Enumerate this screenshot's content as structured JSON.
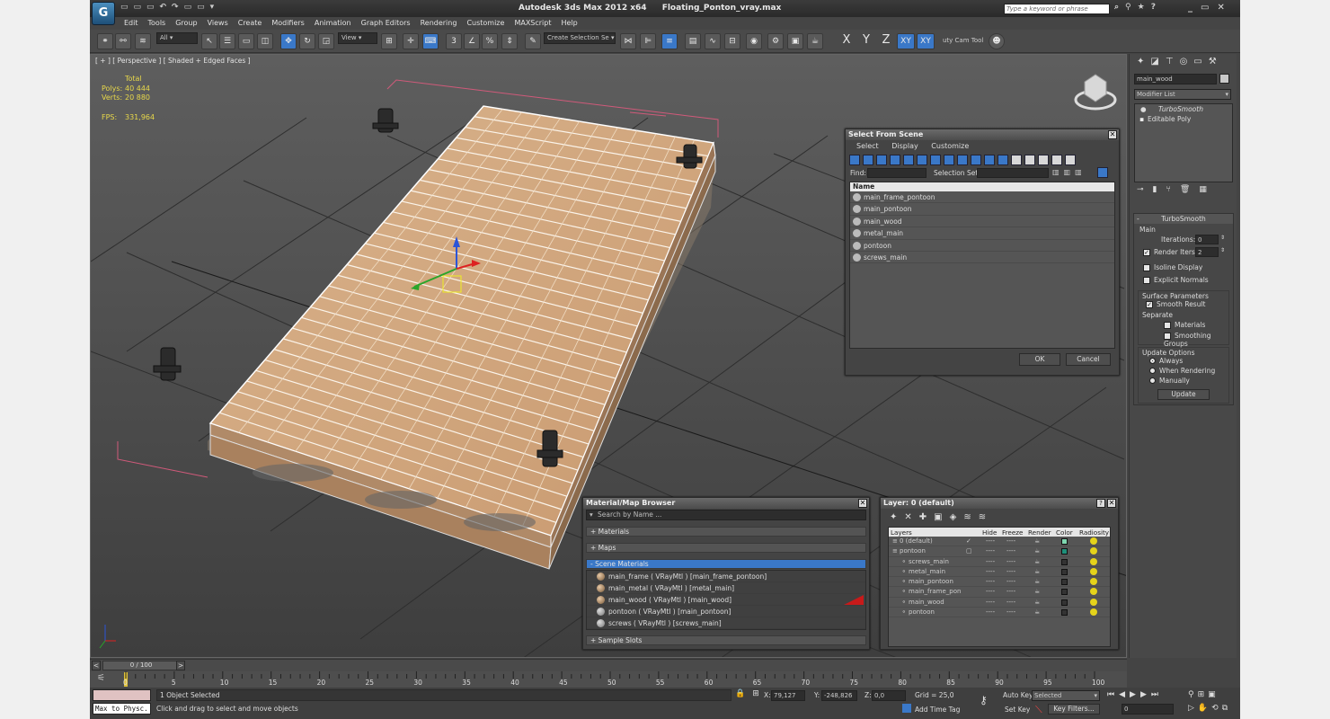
{
  "title": {
    "app": "Autodesk 3ds Max  2012 x64",
    "file": "Floating_Ponton_vray.max",
    "search_placeholder": "Type a keyword or phrase"
  },
  "menu": [
    "Edit",
    "Tools",
    "Group",
    "Views",
    "Create",
    "Modifiers",
    "Animation",
    "Graph Editors",
    "Rendering",
    "Customize",
    "MAXScript",
    "Help"
  ],
  "toolbar": {
    "filter": "All",
    "ref_coord": "View",
    "selection_set": "Create Selection Se",
    "axes": [
      "X",
      "Y",
      "Z",
      "XY",
      "XY"
    ],
    "cam_tool": "uty Cam Tool"
  },
  "viewport": {
    "label": "[ + ] [ Perspective ] [ Shaded + Edged Faces ]",
    "stats_header": "Total",
    "polys_label": "Polys:",
    "polys_value": "40 444",
    "verts_label": "Verts:",
    "verts_value": "20 880",
    "fps_label": "FPS:",
    "fps_value": "331,964"
  },
  "select_scene": {
    "title": "Select From Scene",
    "tabs": [
      "Select",
      "Display",
      "Customize"
    ],
    "find_label": "Find:",
    "selset_label": "Selection Set:",
    "col_name": "Name",
    "items": [
      "main_frame_pontoon",
      "main_pontoon",
      "main_wood",
      "metal_main",
      "pontoon",
      "screws_main"
    ],
    "ok": "OK",
    "cancel": "Cancel"
  },
  "material_browser": {
    "title": "Material/Map Browser",
    "search_placeholder": "Search by Name ...",
    "sections": [
      "+ Materials",
      "+ Maps",
      "- Scene Materials",
      "+ Sample Slots"
    ],
    "materials": [
      "main_frame  ( VRayMtl ) [main_frame_pontoon]",
      "main_metal  ( VRayMtl ) [metal_main]",
      "main_wood  ( VRayMtl ) [main_wood]",
      "pontoon  ( VRayMtl ) [main_pontoon]",
      "screws  ( VRayMtl ) [screws_main]"
    ]
  },
  "layer_manager": {
    "title": "Layer: 0 (default)",
    "help": "?",
    "headers": [
      "Layers",
      "Hide",
      "Freeze",
      "Render",
      "Color",
      "Radiosity"
    ],
    "layers": [
      {
        "name": "0 (default)",
        "color": "#7fd6b0"
      },
      {
        "name": "pontoon",
        "color": "#1e8f7a"
      },
      {
        "name": "screws_main",
        "color": "#333333"
      },
      {
        "name": "metal_main",
        "color": "#333333"
      },
      {
        "name": "main_pontoon",
        "color": "#333333"
      },
      {
        "name": "main_frame_pon",
        "color": "#333333"
      },
      {
        "name": "main_wood",
        "color": "#333333"
      },
      {
        "name": "pontoon",
        "color": "#333333"
      }
    ],
    "dashes": "----"
  },
  "command_panel": {
    "object_name": "main_wood",
    "modifier_list": "Modifier List",
    "stack": [
      "TurboSmooth",
      "Editable Poly"
    ],
    "rollout_title": "TurboSmooth",
    "main_label": "Main",
    "iterations_label": "Iterations:",
    "iterations_value": "0",
    "render_iters_label": "Render Iters:",
    "render_iters_value": "2",
    "isoline": "Isoline Display",
    "explicit": "Explicit Normals",
    "surface_params": "Surface Parameters",
    "smooth_result": "Smooth Result",
    "separate": "Separate",
    "materials": "Materials",
    "smoothing_groups": "Smoothing Groups",
    "update_options": "Update Options",
    "always": "Always",
    "when_rendering": "When Rendering",
    "manually": "Manually",
    "update_btn": "Update"
  },
  "timeline": {
    "slider": "0 / 100",
    "ticks": [
      "0",
      "5",
      "10",
      "15",
      "20",
      "25",
      "30",
      "35",
      "40",
      "45",
      "50",
      "55",
      "60",
      "65",
      "70",
      "75",
      "80",
      "85",
      "90",
      "95",
      "100"
    ]
  },
  "status": {
    "maxscript": "Max to Physc.",
    "selected": "1 Object Selected",
    "prompt": "Click and drag to select and move objects",
    "x_label": "X:",
    "x_value": "79,127",
    "y_label": "Y:",
    "y_value": "-248,826",
    "z_label": "Z:",
    "z_value": "0,0",
    "grid": "Grid = 25,0",
    "add_time_tag": "Add Time Tag",
    "auto_key": "Auto Key",
    "set_key": "Set Key",
    "selected_dd": "Selected",
    "key_filters": "Key Filters...",
    "frame": "0"
  }
}
